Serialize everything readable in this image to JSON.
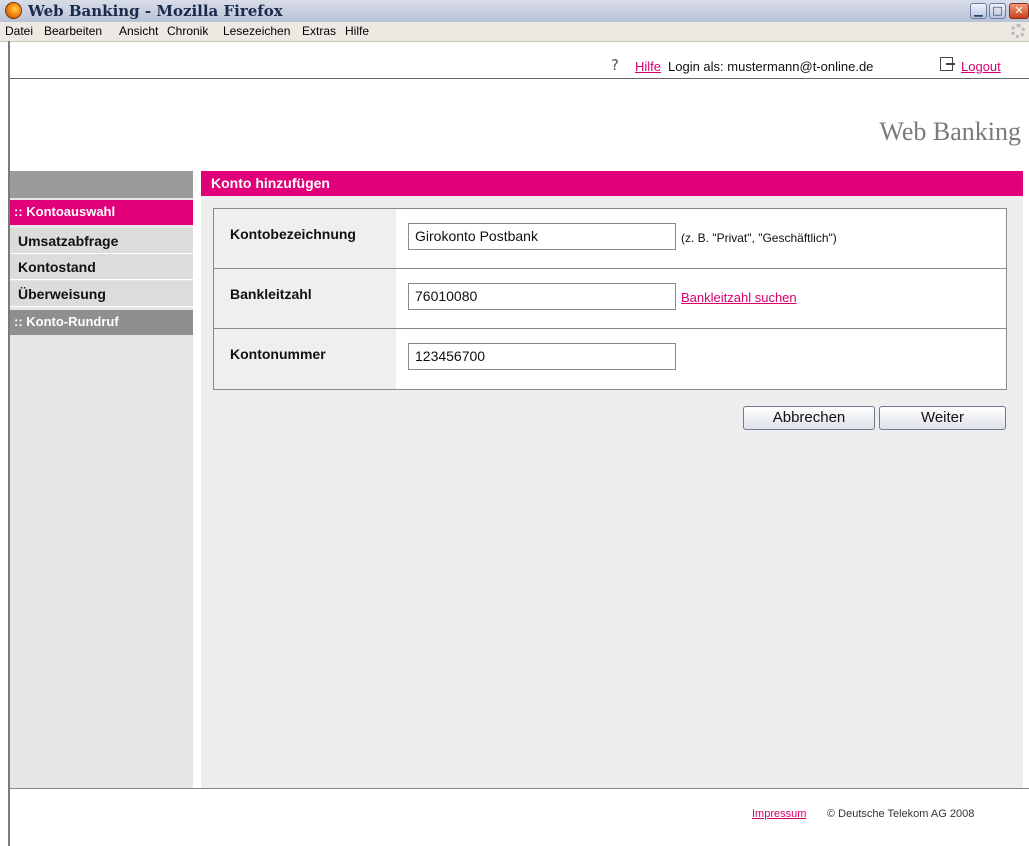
{
  "window": {
    "title": "Web Banking - Mozilla Firefox"
  },
  "menubar": [
    "Datei",
    "Bearbeiten",
    "Ansicht",
    "Chronik",
    "Lesezeichen",
    "Extras",
    "Hilfe"
  ],
  "utility": {
    "help_label": "Hilfe",
    "login_text": "Login als: mustermann@t-online.de",
    "logout_label": "Logout"
  },
  "brand": "Web Banking",
  "sidebar": {
    "section_active": ":: Kontoauswahl",
    "items": [
      "Umsatzabfrage",
      "Kontostand",
      "Überweisung"
    ],
    "section_inactive": ":: Konto-Rundruf"
  },
  "panel": {
    "title": "Konto hinzufügen",
    "rows": [
      {
        "label": "Kontobezeichnung",
        "value": "Girokonto Postbank",
        "hint": "(z. B. \"Privat\", \"Geschäftlich\")"
      },
      {
        "label": "Bankleitzahl",
        "value": "76010080",
        "link": "Bankleitzahl suchen"
      },
      {
        "label": "Kontonummer",
        "value": "123456700"
      }
    ],
    "cancel_label": "Abbrechen",
    "next_label": "Weiter"
  },
  "footer": {
    "impressum": "Impressum",
    "copyright": "© Deutsche Telekom AG 2008"
  },
  "colors": {
    "accent": "#e2007a",
    "nav_inactive": "#8f8f8f"
  }
}
